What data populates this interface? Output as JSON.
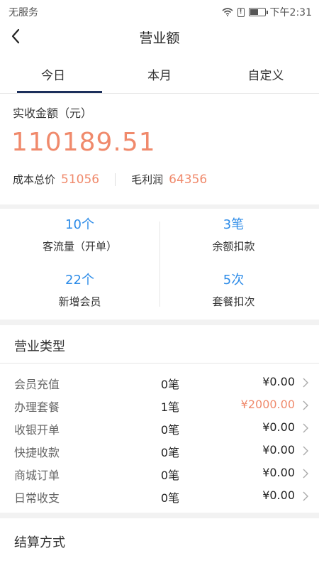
{
  "status_bar": {
    "carrier": "无服务",
    "time": "下午2:31",
    "battery_level": 0.6,
    "icons": [
      "wifi-icon",
      "sim-alert-icon",
      "battery-icon"
    ]
  },
  "header": {
    "title": "营业额",
    "back_icon": "chevron-left-icon"
  },
  "tabs": [
    {
      "label": "今日",
      "active": true
    },
    {
      "label": "本月",
      "active": false
    },
    {
      "label": "自定义",
      "active": false
    }
  ],
  "revenue": {
    "label": "实收金额（元）",
    "amount": "110189.51",
    "cost_label": "成本总价",
    "cost_value": "51056",
    "profit_label": "毛利润",
    "profit_value": "64356"
  },
  "stats": [
    {
      "value": "10个",
      "caption": "客流量（开单）"
    },
    {
      "value": "3笔",
      "caption": "余额扣款"
    },
    {
      "value": "22个",
      "caption": "新增会员"
    },
    {
      "value": "5次",
      "caption": "套餐扣次"
    }
  ],
  "business_types": {
    "title": "营业类型",
    "rows": [
      {
        "name": "会员充值",
        "count": "0笔",
        "amount": "¥0.00",
        "highlight": false
      },
      {
        "name": "办理套餐",
        "count": "1笔",
        "amount": "¥2000.00",
        "highlight": true
      },
      {
        "name": "收银开单",
        "count": "0笔",
        "amount": "¥0.00",
        "highlight": false
      },
      {
        "name": "快捷收款",
        "count": "0笔",
        "amount": "¥0.00",
        "highlight": false
      },
      {
        "name": "商城订单",
        "count": "0笔",
        "amount": "¥0.00",
        "highlight": false
      },
      {
        "name": "日常收支",
        "count": "0笔",
        "amount": "¥0.00",
        "highlight": false
      }
    ]
  },
  "settlement": {
    "title": "结算方式"
  },
  "colors": {
    "accent_orange": "#f08a6c",
    "accent_blue": "#2e8ce8",
    "tab_indicator": "#1c2f5b"
  }
}
